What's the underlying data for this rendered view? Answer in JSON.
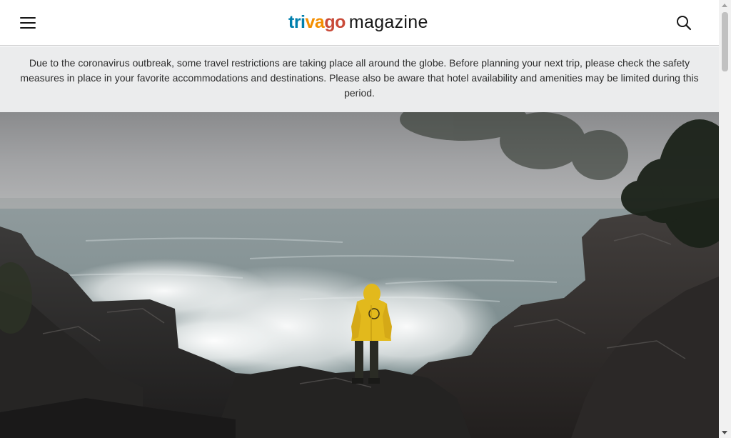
{
  "header": {
    "menu_icon": "hamburger-menu-icon",
    "logo": {
      "tri": "tri",
      "va": "va",
      "go": "go",
      "magazine": "magazine"
    },
    "search_icon": "search-icon"
  },
  "notice": {
    "text": "Due to the coronavirus outbreak, some travel restrictions are taking place all around the globe. Before planning your next trip, please check the safety measures in place in your favorite accommodations and destinations. Please also be aware that hotel availability and amenities may be limited during this period."
  },
  "hero": {
    "subject": "person-in-yellow-raincoat-on-rocky-coast"
  },
  "colors": {
    "logo_blue": "#007fad",
    "logo_orange": "#f48f00",
    "logo_red": "#c94a38",
    "notice_bg": "#ebeced",
    "raincoat_yellow": "#e2b91c"
  }
}
